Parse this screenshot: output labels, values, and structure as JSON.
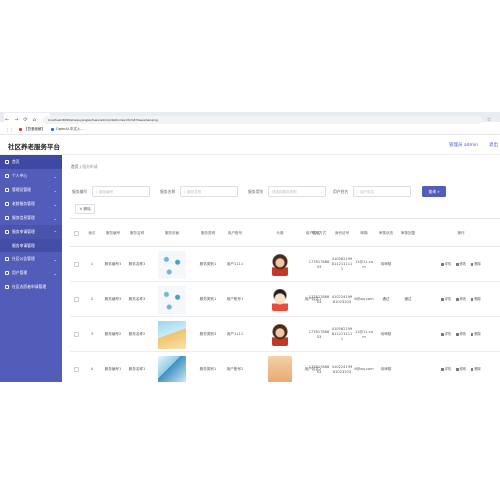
{
  "browser": {
    "url": "localhost:8080/shequyanglaofuwu/admin/dist/index.html#/fuwushenqing",
    "bookmarks": [
      {
        "label": "【吾爱破解】",
        "color": "#d33"
      },
      {
        "label": "OpenAI 中文入...",
        "color": "#1a73e8"
      }
    ]
  },
  "header": {
    "title": "社区养老服务平台",
    "admin": "管理员 admin",
    "logout": "退出"
  },
  "sidebar": {
    "items": [
      {
        "label": "首页"
      },
      {
        "label": "个人中心"
      },
      {
        "label": "管理员管理"
      },
      {
        "label": "老龄服务管理"
      },
      {
        "label": "服务信息管理"
      },
      {
        "label": "服务申请管理"
      },
      {
        "label": "服务申请管理"
      },
      {
        "label": "社区公告管理"
      },
      {
        "label": "用户管理"
      },
      {
        "label": "社区志愿者申请管理"
      }
    ]
  },
  "breadcrumb": {
    "home": "首页",
    "current": "服务申请"
  },
  "search": {
    "fields": [
      {
        "label": "服务编号",
        "placeholder": "服务编号"
      },
      {
        "label": "服务名称",
        "placeholder": "服务名称"
      },
      {
        "label": "服务类别",
        "placeholder": "请选择服务类别"
      },
      {
        "label": "用户姓名",
        "placeholder": "用户姓名"
      }
    ],
    "button": "查询"
  },
  "toolbar": {
    "delete": "删除"
  },
  "table": {
    "columns": [
      "索引",
      "服务编号",
      "服务名称",
      "服务封面",
      "服务类别",
      "用户账号",
      "头像",
      "用户姓名",
      "联系方式",
      "身份证号",
      "邮箱",
      "审核状态",
      "审核回复",
      "操作"
    ],
    "operations": [
      "详情",
      "修改",
      "删除"
    ],
    "rows": [
      {
        "index": "1",
        "code": "服务编号3",
        "name": "服务名称3",
        "category": "服务类别1",
        "account": "用户1111",
        "user_name": "",
        "phone": "17781786853",
        "id_card": "4105621998112111111",
        "email": "11@11.com",
        "status": "待审核",
        "reply": ""
      },
      {
        "index": "2",
        "code": "服务编号3",
        "name": "服务名称3",
        "category": "服务类别1",
        "account": "用户账号1",
        "user_name": "用户姓名1",
        "phone": "17781786853",
        "id_card": "41022419981023203",
        "email": "8@qq.com",
        "status": "通过",
        "reply": "通过"
      },
      {
        "index": "3",
        "code": "服务编号2",
        "name": "服务名称2",
        "category": "服务类别3",
        "account": "用户1111",
        "user_name": "",
        "phone": "17781786853",
        "id_card": "4105621998112111111",
        "email": "11@11.com",
        "status": "待审核",
        "reply": ""
      },
      {
        "index": "4",
        "code": "服务编号1",
        "name": "服务名称1",
        "category": "服务类别1",
        "account": "用户账号2",
        "user_name": "用户姓名2",
        "phone": "17781786853",
        "id_card": "41022419981023203",
        "email": "8@qq.com",
        "status": "待审核",
        "reply": ""
      }
    ]
  }
}
